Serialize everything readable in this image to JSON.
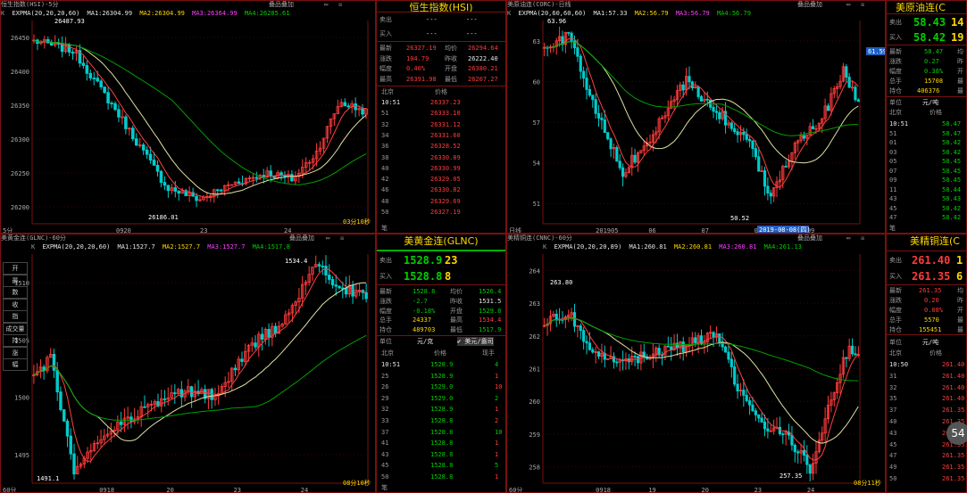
{
  "panels": {
    "hsi": {
      "title": "恒生指数(HSI)-5分",
      "btn": "叠品叠加",
      "ma": [
        "K",
        "EXPMA(20,20,20,60)",
        "MA1:26304.99",
        "MA2:26304.99",
        "MA3:26364.99",
        "MA4:26285.61"
      ],
      "yticks": [
        "26450",
        "26400",
        "26350",
        "26300",
        "26250",
        "26200"
      ],
      "xticks": [
        "5分",
        "0920",
        "23",
        "24"
      ],
      "hi_label": "26487.93",
      "lo_label": "26186.01",
      "timer": "03分10秒",
      "colors": {
        "k": "#00cccc",
        "ma1": "#ff4040",
        "ma2": "#ff40ff",
        "ma4": "#00a000"
      }
    },
    "oil": {
      "title": "美原油连(CORC)-日线",
      "btn": "叠品叠加",
      "ma": [
        "K",
        "EXPMA(20,60,60,60)",
        "MA1:57.33",
        "MA2:56.79",
        "MA3:56.79",
        "MA4:56.79"
      ],
      "yticks": [
        "63",
        "60",
        "57",
        "54",
        "51"
      ],
      "xticks": [
        "日线",
        "201905",
        "06",
        "07",
        "08",
        "09"
      ],
      "hi_label": "63.96",
      "lo_label": "50.52",
      "date_label": "2019-08-08(四)",
      "price_tag": "61.59"
    },
    "gold": {
      "title": "美黄金连(GLNC)-60分",
      "btn": "叠品叠加",
      "ma": [
        "K",
        "EXPMA(20,20,20,60)",
        "MA1:1527.7",
        "MA2:1527.7",
        "MA3:1527.7",
        "MA4:1517.8"
      ],
      "yticks": [
        "1510",
        "1505",
        "1500",
        "1495"
      ],
      "xticks": [
        "60分",
        "0918",
        "20",
        "23",
        "24"
      ],
      "hi_label": "1534.4",
      "lo_label": "1491.1",
      "timer": "08分10秒",
      "side": [
        "开",
        "最",
        "数",
        "收",
        "指",
        "成交量",
        "持",
        "涨",
        "幅"
      ]
    },
    "copper": {
      "title": "美精铜连(CNNC)-60分",
      "btn": "叠品叠加",
      "ma": [
        "K",
        "EXPMA(20,20,20,89)",
        "MA1:260.81",
        "MA2:260.81",
        "MA3:260.81",
        "MA4:261.13"
      ],
      "yticks": [
        "264",
        "263",
        "262",
        "261",
        "260",
        "259",
        "258"
      ],
      "xticks": [
        "60分",
        "0918",
        "19",
        "20",
        "23",
        "24"
      ],
      "hi_label": "263.80",
      "lo_label": "257.35",
      "timer": "08分11秒",
      "badge": "54"
    }
  },
  "quotes": {
    "hsi": {
      "title": "恒生指数(HSI)",
      "sell": [
        "卖出",
        "---",
        "---"
      ],
      "buy": [
        "买入",
        "---",
        "---"
      ],
      "stats": [
        [
          "最新",
          "26327.19",
          "均价",
          "26294.64"
        ],
        [
          "涨跌",
          "104.79",
          "昨收",
          "26222.40"
        ],
        [
          "幅度",
          "0.40%",
          "开盘",
          "26380.21"
        ],
        [
          "最高",
          "26391.98",
          "最低",
          "26207.27"
        ]
      ],
      "hdr": [
        "北京",
        "价格"
      ],
      "ticks": [
        [
          "10:51",
          "26337.23"
        ],
        [
          "51",
          "26333.10"
        ],
        [
          "32",
          "26331.12"
        ],
        [
          "34",
          "26331.60"
        ],
        [
          "36",
          "26328.52"
        ],
        [
          "38",
          "26330.89"
        ],
        [
          "40",
          "26330.99"
        ],
        [
          "42",
          "26329.05"
        ],
        [
          "46",
          "26330.82"
        ],
        [
          "48",
          "26329.69"
        ],
        [
          "50",
          "26327.19"
        ]
      ]
    },
    "oil": {
      "title": "美原油连(C",
      "sell": [
        "卖出",
        "58.43",
        "14"
      ],
      "buy": [
        "买入",
        "58.42",
        "19"
      ],
      "stats": [
        [
          "最新",
          "58.47",
          "均"
        ],
        [
          "涨跌",
          "0.27",
          "昨"
        ],
        [
          "幅度",
          "0.38%",
          "开"
        ],
        [
          "总手",
          "15708",
          "最"
        ],
        [
          "持仓",
          "406376",
          "最"
        ]
      ],
      "hdr": [
        "单位",
        "元/吨"
      ],
      "hdr2": [
        "北京",
        "价格"
      ],
      "ticks": [
        [
          "10:51",
          "58.47"
        ],
        [
          "51",
          "58.47"
        ],
        [
          "01",
          "58.42"
        ],
        [
          "03",
          "58.42"
        ],
        [
          "05",
          "58.45"
        ],
        [
          "07",
          "58.45"
        ],
        [
          "09",
          "58.45"
        ],
        [
          "11",
          "58.44"
        ],
        [
          "43",
          "58.43"
        ],
        [
          "45",
          "58.42"
        ],
        [
          "47",
          "58.42"
        ]
      ]
    },
    "gold": {
      "title": "美黄金连(GLNC)",
      "sell": [
        "卖出",
        "1528.9",
        "23"
      ],
      "buy": [
        "买入",
        "1528.8",
        "8"
      ],
      "stats": [
        [
          "最新",
          "1528.8",
          "均价",
          "1526.4"
        ],
        [
          "涨跌",
          "-2.7",
          "昨收",
          "1531.5"
        ],
        [
          "幅度",
          "-0.18%",
          "开盘",
          "1529.8"
        ],
        [
          "总手",
          "24337",
          "最高",
          "1534.4"
        ],
        [
          "持仓",
          "489703",
          "最低",
          "1517.9"
        ]
      ],
      "hdr": [
        "单位",
        "元/克",
        "✔ 美元/盎司"
      ],
      "hdr2": [
        "北京",
        "价格",
        "现手"
      ],
      "ticks": [
        [
          "10:51",
          "1528.9",
          "4"
        ],
        [
          "25",
          "1528.9",
          "1"
        ],
        [
          "26",
          "1529.0",
          "10"
        ],
        [
          "29",
          "1529.0",
          "2"
        ],
        [
          "32",
          "1528.9",
          "1"
        ],
        [
          "33",
          "1528.8",
          "2"
        ],
        [
          "37",
          "1528.8",
          "10"
        ],
        [
          "41",
          "1528.8",
          "1"
        ],
        [
          "43",
          "1528.8",
          "1"
        ],
        [
          "45",
          "1528.8",
          "5"
        ],
        [
          "50",
          "1528.8",
          "1"
        ]
      ]
    },
    "copper": {
      "title": "美精铜连(C",
      "sell": [
        "卖出",
        "261.40",
        "1"
      ],
      "buy": [
        "买入",
        "261.35",
        "6"
      ],
      "stats": [
        [
          "最新",
          "261.35",
          "均"
        ],
        [
          "涨跌",
          "0.20",
          "昨"
        ],
        [
          "幅度",
          "0.08%",
          "开"
        ],
        [
          "总手",
          "5570",
          "最"
        ],
        [
          "持仓",
          "155451",
          "最"
        ]
      ],
      "hdr": [
        "单位",
        "元/吨"
      ],
      "hdr2": [
        "北京",
        "价格"
      ],
      "ticks": [
        [
          "10:50",
          "261.40"
        ],
        [
          "31",
          "261.40"
        ],
        [
          "32",
          "261.40"
        ],
        [
          "35",
          "261.40"
        ],
        [
          "37",
          "261.35"
        ],
        [
          "40",
          "261.35"
        ],
        [
          "43",
          "261.35"
        ],
        [
          "45",
          "261.35"
        ],
        [
          "47",
          "261.35"
        ],
        [
          "49",
          "261.35"
        ],
        [
          "50",
          "261.35"
        ]
      ]
    }
  }
}
